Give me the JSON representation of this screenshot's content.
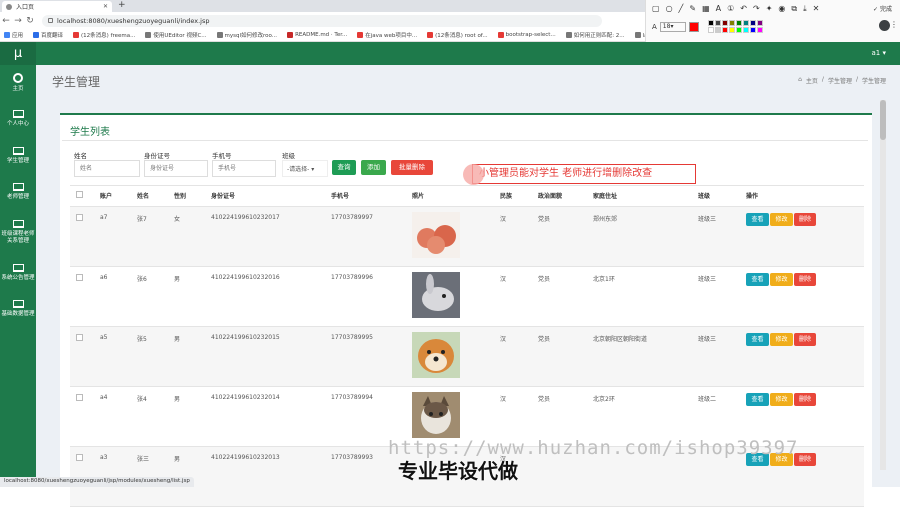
{
  "browser": {
    "tab_title": "入口页",
    "url": "localhost:8080/xueshengzuoyeguanli/index.jsp",
    "bookmarks": [
      {
        "label": "应用",
        "color": "#4285f4"
      },
      {
        "label": "百度翻译",
        "color": "#2b6de8"
      },
      {
        "label": "(12条消息) freema...",
        "color": "#e53935"
      },
      {
        "label": "使用UEditor 视频C...",
        "color": "#777777"
      },
      {
        "label": "mysql如何修改roo...",
        "color": "#777777"
      },
      {
        "label": "README.md · Ter...",
        "color": "#c62828"
      },
      {
        "label": "在java web项目中...",
        "color": "#e53935"
      },
      {
        "label": "(12条消息) root of...",
        "color": "#e53935"
      },
      {
        "label": "bootstrap-select...",
        "color": "#e53935"
      },
      {
        "label": "如何用正则匹配: 2...",
        "color": "#777777"
      },
      {
        "label": "layDate - JS日期...",
        "color": "#777777"
      }
    ],
    "status_url": "localhost:8080/xueshengzuoyeguanli/jsp/modules/xuesheng/list.jsp"
  },
  "annotation_toolbar": {
    "font_label": "A",
    "font_size": "18",
    "done_label": "完成",
    "active_color": "#ff0000"
  },
  "app": {
    "logo": "μ",
    "user": "a1 ▾",
    "sidebar": [
      {
        "label": "主页",
        "icon": "dashboard-icon"
      },
      {
        "label": "个人中心",
        "icon": "monitor-icon"
      },
      {
        "label": "学生管理",
        "icon": "monitor-icon"
      },
      {
        "label": "老师管理",
        "icon": "monitor-icon"
      },
      {
        "label": "班级课程老师关系管理",
        "icon": "monitor-icon"
      },
      {
        "label": "系统公告管理",
        "icon": "monitor-icon"
      },
      {
        "label": "基础数据管理",
        "icon": "monitor-icon"
      }
    ],
    "page_title": "学生管理",
    "breadcrumb": [
      "主页",
      "学生管理",
      "学生管理"
    ]
  },
  "list": {
    "title": "学生列表",
    "filters": {
      "name_label": "姓名",
      "name_placeholder": "姓名",
      "id_label": "身份证号",
      "id_placeholder": "身份证号",
      "phone_label": "手机号",
      "phone_placeholder": "手机号",
      "class_label": "班级",
      "class_value": "-请选择-"
    },
    "buttons": {
      "search": "查询",
      "add": "添加",
      "batch_delete": "批量删除"
    },
    "columns": [
      "账户",
      "姓名",
      "性别",
      "身份证号",
      "手机号",
      "照片",
      "民族",
      "政治面貌",
      "家庭住址",
      "班级",
      "操作"
    ],
    "rows": [
      {
        "account": "a7",
        "name": "张7",
        "gender": "女",
        "id": "410224199610232017",
        "phone": "17703789997",
        "photo": "apples-photo",
        "ethnic": "汉",
        "political": "党员",
        "address": "郑州东郊",
        "class": "班级三"
      },
      {
        "account": "a6",
        "name": "张6",
        "gender": "男",
        "id": "410224199610232016",
        "phone": "17703789996",
        "photo": "rabbit-photo",
        "ethnic": "汉",
        "political": "党员",
        "address": "北京1环",
        "class": "班级三"
      },
      {
        "account": "a5",
        "name": "张5",
        "gender": "男",
        "id": "410224199610232015",
        "phone": "17703789995",
        "photo": "shiba-dog-photo",
        "ethnic": "汉",
        "political": "党员",
        "address": "北京朝阳区朝阳街道",
        "class": "班级三"
      },
      {
        "account": "a4",
        "name": "张4",
        "gender": "男",
        "id": "410224199610232014",
        "phone": "17703789994",
        "photo": "cat-photo",
        "ethnic": "汉",
        "political": "党员",
        "address": "北京2环",
        "class": "班级二"
      },
      {
        "account": "a3",
        "name": "张三",
        "gender": "男",
        "id": "410224199610232013",
        "phone": "17703789993",
        "photo": "",
        "ethnic": "汉",
        "political": "",
        "address": "",
        "class": ""
      }
    ],
    "row_actions": {
      "view": "查看",
      "edit": "修改",
      "delete": "删除"
    }
  },
  "overlay": {
    "callout": "小管理员能对学生 老师进行增删除改查",
    "watermark": "https://www.huzhan.com/ishop39397",
    "caption": "专业毕设代做"
  },
  "colors": {
    "brand": "#1e7a4b",
    "search_btn": "#1e9c55",
    "add_btn": "#3aa84c",
    "delete_btn": "#e8473a",
    "view_btn": "#17a2b8",
    "edit_btn": "#f0ad1a",
    "del_btn": "#e8473a"
  }
}
